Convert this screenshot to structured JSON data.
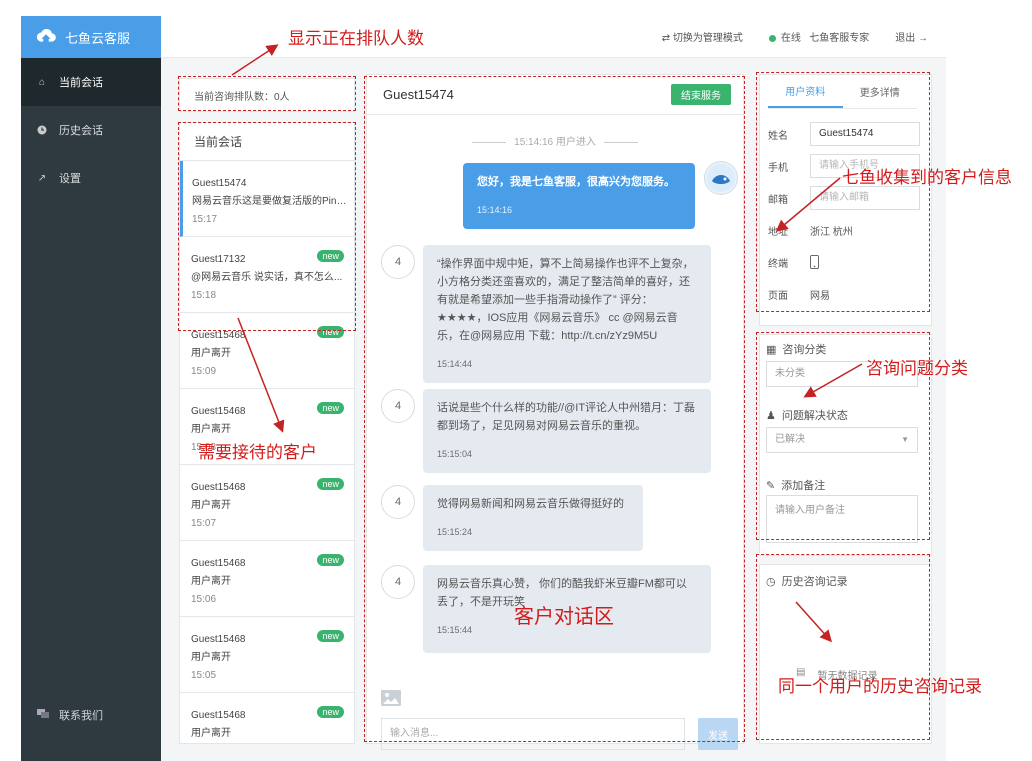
{
  "brand": {
    "name": "七鱼云客服"
  },
  "nav": [
    {
      "label": "当前会话",
      "icon": "home-icon",
      "active": true
    },
    {
      "label": "历史会话",
      "icon": "clock-icon",
      "active": false
    },
    {
      "label": "设置",
      "icon": "wrench-icon",
      "active": false
    }
  ],
  "contact": {
    "label": "联系我们"
  },
  "topbar": {
    "switch_label": "切换为管理模式",
    "status": "在线",
    "user": "七鱼客服专家",
    "logout": "退出"
  },
  "queue": {
    "text": "当前咨询排队数：0人"
  },
  "sessions": {
    "header": "当前会话",
    "items": [
      {
        "name": "Guest15474",
        "msg": "网易云音乐这是要做复活版的Ping...",
        "time": "15:17",
        "new": false,
        "selected": true
      },
      {
        "name": "Guest17132",
        "msg": "@网易云音乐 说实话，真不怎么...",
        "time": "15:18",
        "new": true
      },
      {
        "name": "Guest15468",
        "msg": "用户离开",
        "time": "15:09",
        "new": true
      },
      {
        "name": "Guest15468",
        "msg": "用户离开",
        "time": "15:08",
        "new": true
      },
      {
        "name": "Guest15468",
        "msg": "用户离开",
        "time": "15:07",
        "new": true
      },
      {
        "name": "Guest15468",
        "msg": "用户离开",
        "time": "15:06",
        "new": true
      },
      {
        "name": "Guest15468",
        "msg": "用户离开",
        "time": "15:05",
        "new": true
      },
      {
        "name": "Guest15468",
        "msg": "用户离开",
        "time": "",
        "new": true
      }
    ],
    "new_label": "new"
  },
  "chat": {
    "title": "Guest15474",
    "end_button": "结束服务",
    "system": "15:14:16 用户进入",
    "avatar_guest": "4",
    "messages": [
      {
        "text": "您好，我是七鱼客服，很高兴为您服务。",
        "time": "15:14:16"
      },
      {
        "text": "“操作界面中规中矩，算不上简易操作也评不上复杂，小方格分类还蛮喜欢的，满足了整洁简单的喜好，还有就是希望添加一些手指滑动操作了” 评分：★★★★，IOS应用《网易云音乐》 cc @网易云音乐，在@网易应用 下载：http://t.cn/zYz9M5U",
        "time": "15:14:44"
      },
      {
        "text": "话说是些个什么样的功能//@IT评论人中州猎月：丁磊都到场了，足见网易对网易云音乐的重视。",
        "time": "15:15:04"
      },
      {
        "text": "觉得网易新闻和网易云音乐做得挺好的",
        "time": "15:15:24"
      },
      {
        "text": "网易云音乐真心赞， 你们的酷我虾米豆瓣FM都可以丢了，不是开玩笑",
        "time": "15:15:44"
      }
    ],
    "input_placeholder": "输入消息...",
    "send": "发送"
  },
  "info": {
    "tabs": [
      "用户资料",
      "更多详情"
    ],
    "fields": [
      {
        "label": "姓名",
        "value": "Guest15474",
        "type": "input"
      },
      {
        "label": "手机",
        "value": "请输入手机号",
        "type": "placeholder"
      },
      {
        "label": "邮箱",
        "value": "请输入邮箱",
        "type": "placeholder"
      },
      {
        "label": "地址",
        "value": "浙江 杭州",
        "type": "text"
      },
      {
        "label": "终端",
        "value": "",
        "type": "device"
      },
      {
        "label": "页面",
        "value": "网易",
        "type": "text"
      }
    ]
  },
  "category": {
    "title": "咨询分类",
    "value": "未分类",
    "status_title": "问题解决状态",
    "status_value": "已解决",
    "note_title": "添加备注",
    "note_placeholder": "请输入用户备注"
  },
  "history": {
    "title": "历史咨询记录",
    "empty": "暂无数据记录"
  },
  "annotations": {
    "queue": "显示正在排队人数",
    "info": "七鱼收集到的客户信息",
    "category": "咨询问题分类",
    "customers": "需要接待的客户",
    "chat": "客户对话区",
    "history": "同一个用户的历史咨询记录"
  },
  "colors": {
    "primary": "#4a9ee8",
    "success": "#3ab36e",
    "sidebar": "#2f3a40",
    "annotation": "#d21c1c"
  }
}
